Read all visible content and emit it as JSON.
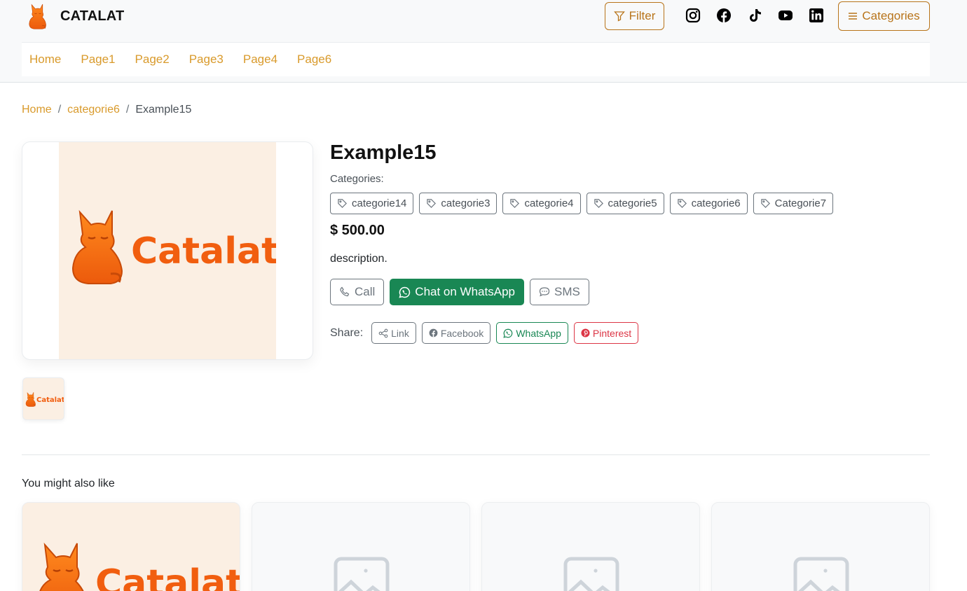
{
  "brand": {
    "name": "CATALAT",
    "logo_icon": "cat-logo-icon"
  },
  "header": {
    "filter_label": "Filter",
    "categories_label": "Categories",
    "social_icons": [
      "instagram-icon",
      "facebook-icon",
      "tiktok-icon",
      "youtube-icon",
      "linkedin-icon"
    ]
  },
  "nav": {
    "items": [
      "Home",
      "Page1",
      "Page2",
      "Page3",
      "Page4",
      "Page6"
    ]
  },
  "breadcrumb": {
    "home": "Home",
    "category": "categorie6",
    "current": "Example15"
  },
  "product": {
    "title": "Example15",
    "categories_label": "Categories:",
    "tags": [
      "categorie14",
      "categorie3",
      "categorie4",
      "categorie5",
      "categorie6",
      "Categorie7"
    ],
    "price": "$ 500.00",
    "description": "description.",
    "image_text": "Catalat",
    "thumb_text": "Catalat"
  },
  "actions": {
    "call": "Call",
    "whatsapp": "Chat on WhatsApp",
    "sms": "SMS"
  },
  "share": {
    "label": "Share:",
    "link": "Link",
    "facebook": "Facebook",
    "whatsapp": "WhatsApp",
    "pinterest": "Pinterest"
  },
  "related": {
    "title": "You might also like",
    "card1_text": "Catalat"
  },
  "colors": {
    "accent": "#d99a2b",
    "accent_dark": "#b8741a",
    "logo_orange": "#f36a10",
    "whatsapp_green": "#198754",
    "pinterest_red": "#dc3545",
    "image_bg": "#fbefe3"
  }
}
